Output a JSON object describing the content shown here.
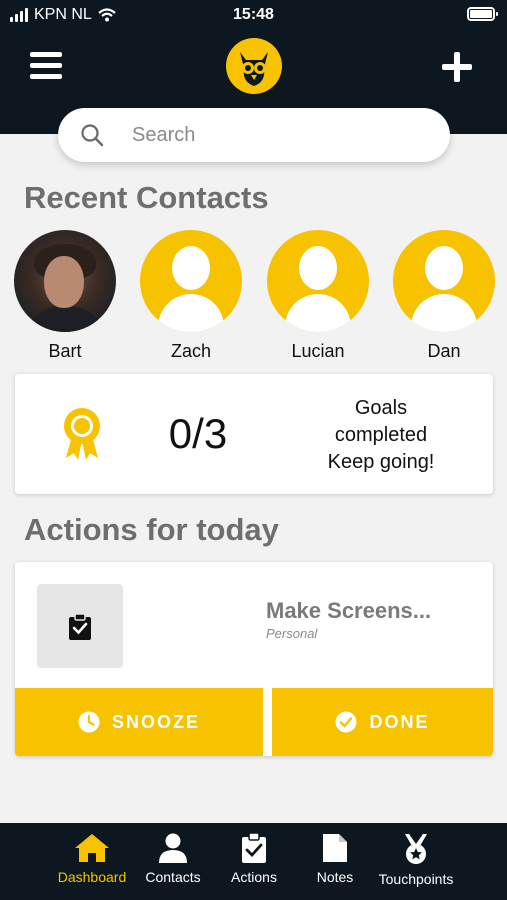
{
  "status_bar": {
    "carrier": "KPN NL",
    "time": "15:48"
  },
  "header": {
    "logo_icon": "owl-logo-icon",
    "menu_icon": "hamburger-icon",
    "add_icon": "plus-icon"
  },
  "search": {
    "placeholder": "Search"
  },
  "recent_contacts": {
    "title": "Recent Contacts",
    "items": [
      {
        "name": "Bart",
        "avatar": "photo"
      },
      {
        "name": "Zach",
        "avatar": "placeholder"
      },
      {
        "name": "Lucian",
        "avatar": "placeholder"
      },
      {
        "name": "Dan",
        "avatar": "placeholder"
      }
    ]
  },
  "goals": {
    "count": "0/3",
    "line1": "Goals",
    "line2": "completed",
    "line3": "Keep going!",
    "icon": "award-ribbon-icon"
  },
  "actions": {
    "title": "Actions for today",
    "items": [
      {
        "title": "Make Screens...",
        "category": "Personal",
        "icon": "clipboard-check-icon"
      }
    ],
    "snooze_label": "SNOOZE",
    "done_label": "DONE"
  },
  "tabbar": {
    "items": [
      {
        "label": "Dashboard",
        "icon": "home-icon",
        "active": true
      },
      {
        "label": "Contacts",
        "icon": "person-icon",
        "active": false
      },
      {
        "label": "Actions",
        "icon": "clipboard-check-icon",
        "active": false
      },
      {
        "label": "Notes",
        "icon": "document-icon",
        "active": false
      },
      {
        "label": "Touchpoints",
        "icon": "medal-icon",
        "active": false
      }
    ]
  },
  "colors": {
    "accent": "#f7c200",
    "dark": "#0c1720",
    "background": "#f2f2f2",
    "heading": "#6e6e6e"
  }
}
